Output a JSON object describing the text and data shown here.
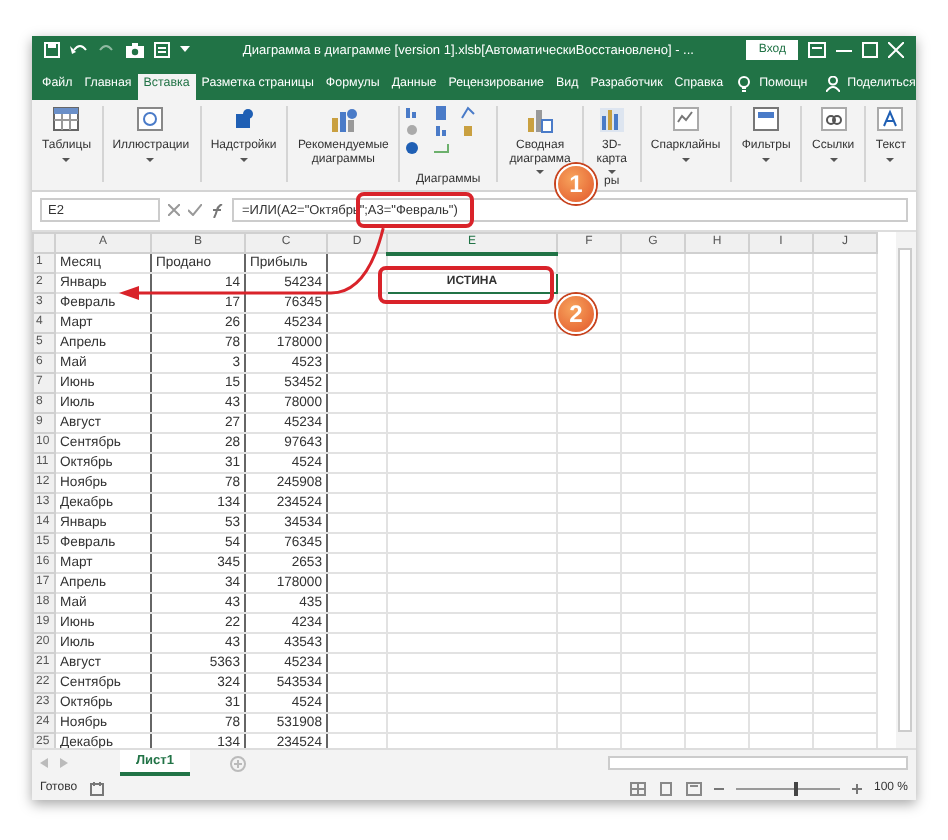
{
  "window": {
    "title": "Диаграмма в диаграмме [version 1].xlsb[АвтоматическиВосстановлено]  -  ...",
    "login_button": "Вход"
  },
  "ribbon_tabs": [
    {
      "label": "Файл",
      "selected": false
    },
    {
      "label": "Главная",
      "selected": false
    },
    {
      "label": "Вставка",
      "selected": true
    },
    {
      "label": "Разметка страницы",
      "selected": false
    },
    {
      "label": "Формулы",
      "selected": false
    },
    {
      "label": "Данные",
      "selected": false
    },
    {
      "label": "Рецензирование",
      "selected": false
    },
    {
      "label": "Вид",
      "selected": false
    },
    {
      "label": "Разработчик",
      "selected": false
    },
    {
      "label": "Справка",
      "selected": false
    }
  ],
  "help": "Помощн",
  "share": "Поделиться",
  "ribbon": [
    {
      "label": "Таблицы",
      "dropdown": true
    },
    {
      "label": "Иллюстрации",
      "dropdown": true
    },
    {
      "label": "Надстройки",
      "dropdown": true
    },
    {
      "label": "Рекомендуемые диаграммы",
      "dropdown": false
    },
    {
      "label": "Сводная диаграмма",
      "dropdown": true
    },
    {
      "label": "3D-карта",
      "dropdown": true
    },
    {
      "label": "Спарклайны",
      "dropdown": true
    },
    {
      "label": "Фильтры",
      "dropdown": true
    },
    {
      "label": "Ссылки",
      "dropdown": true
    },
    {
      "label": "Текст",
      "dropdown": true
    }
  ],
  "ribbon_groups": [
    "Диаграммы",
    "ры"
  ],
  "formula_bar": {
    "name_box": "E2",
    "formula": "=ИЛИ(A2=\"Октябрь\";A3=\"Февраль\")"
  },
  "columns": [
    "A",
    "B",
    "C",
    "D",
    "E",
    "F",
    "G",
    "H",
    "I",
    "J"
  ],
  "rows": [
    {
      "number": "1",
      "cells": [
        "Месяц",
        "Продано",
        "Прибыль"
      ]
    },
    {
      "number": "2",
      "cells": [
        "Январь",
        "14",
        "54234"
      ]
    },
    {
      "number": "3",
      "cells": [
        "Февраль",
        "17",
        "76345"
      ]
    },
    {
      "number": "4",
      "cells": [
        "Март",
        "26",
        "45234"
      ]
    },
    {
      "number": "5",
      "cells": [
        "Апрель",
        "78",
        "178000"
      ]
    },
    {
      "number": "6",
      "cells": [
        "Май",
        "3",
        "4523"
      ]
    },
    {
      "number": "7",
      "cells": [
        "Июнь",
        "15",
        "53452"
      ]
    },
    {
      "number": "8",
      "cells": [
        "Июль",
        "43",
        "78000"
      ]
    },
    {
      "number": "9",
      "cells": [
        "Август",
        "27",
        "45234"
      ]
    },
    {
      "number": "10",
      "cells": [
        "Сентябрь",
        "28",
        "97643"
      ]
    },
    {
      "number": "11",
      "cells": [
        "Октябрь",
        "31",
        "4524"
      ]
    },
    {
      "number": "12",
      "cells": [
        "Ноябрь",
        "78",
        "245908"
      ]
    },
    {
      "number": "13",
      "cells": [
        "Декабрь",
        "134",
        "234524"
      ]
    },
    {
      "number": "14",
      "cells": [
        "Январь",
        "53",
        "34534"
      ]
    },
    {
      "number": "15",
      "cells": [
        "Февраль",
        "54",
        "76345"
      ]
    },
    {
      "number": "16",
      "cells": [
        "Март",
        "345",
        "2653"
      ]
    },
    {
      "number": "17",
      "cells": [
        "Апрель",
        "34",
        "178000"
      ]
    },
    {
      "number": "18",
      "cells": [
        "Май",
        "43",
        "435"
      ]
    },
    {
      "number": "19",
      "cells": [
        "Июнь",
        "22",
        "4234"
      ]
    },
    {
      "number": "20",
      "cells": [
        "Июль",
        "43",
        "43543"
      ]
    },
    {
      "number": "21",
      "cells": [
        "Август",
        "5363",
        "45234"
      ]
    },
    {
      "number": "22",
      "cells": [
        "Сентябрь",
        "324",
        "543534"
      ]
    },
    {
      "number": "23",
      "cells": [
        "Октябрь",
        "31",
        "4524"
      ]
    },
    {
      "number": "24",
      "cells": [
        "Ноябрь",
        "78",
        "531908"
      ]
    },
    {
      "number": "25",
      "cells": [
        "Декабрь",
        "134",
        "234524"
      ]
    }
  ],
  "result_cell": {
    "value": "ИСТИНА",
    "selected": true
  },
  "sheet_tabs": [
    {
      "label": "Лист1",
      "selected": true
    }
  ],
  "status_bar": {
    "status": "Готово",
    "zoom": "100 %",
    "zoom_slider": {
      "level": 0.55
    }
  },
  "callouts": [
    "1",
    "2"
  ]
}
